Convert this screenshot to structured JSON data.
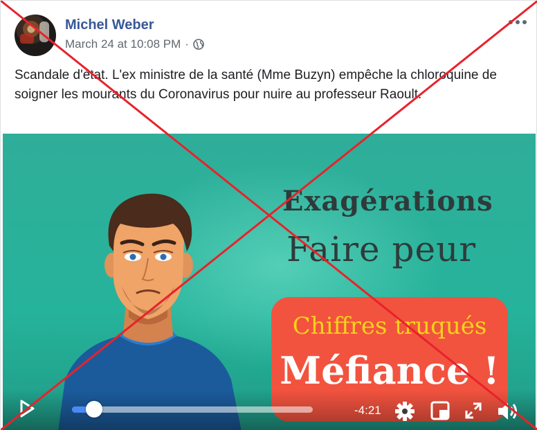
{
  "post": {
    "author": "Michel Weber",
    "timestamp": "March 24 at 10:08 PM",
    "separator": "·",
    "privacy_icon": "globe-icon",
    "menu_icon": "more-options-icon",
    "text": "Scandale d'état. L'ex ministre de la santé (Mme Buzyn) empêche la chloroquine de soigner les mourants du Coronavirus pour nuire au professeur Raoult."
  },
  "video": {
    "headline1": "Exagérations",
    "headline2": "Faire peur",
    "box_line1": "Chiffres truqués",
    "box_line2": "Méfiance !",
    "controls": {
      "time_remaining": "-4:21",
      "progress": 0.08,
      "icons": [
        "play-icon",
        "settings-icon",
        "pip-icon",
        "fullscreen-icon",
        "volume-icon"
      ]
    }
  },
  "overlay": {
    "cross_color": "#e8222b"
  }
}
